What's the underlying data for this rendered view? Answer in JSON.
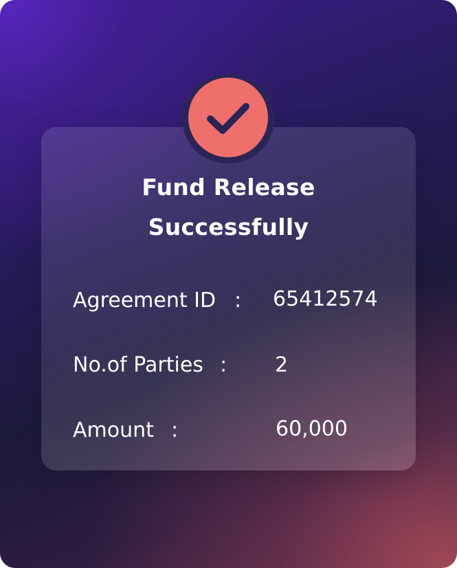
{
  "title": {
    "line1": "Fund Release",
    "line2": "Successfully"
  },
  "badge": {
    "icon": "checkmark-icon",
    "color": "#ef6f6c",
    "check_color": "#2b2456"
  },
  "details": [
    {
      "label": "Agreement ID",
      "separator": ":",
      "value": "65412574"
    },
    {
      "label": "No.of Parties",
      "separator": ":",
      "value": "2"
    },
    {
      "label": "Amount",
      "separator": ":",
      "value": "60,000"
    }
  ],
  "colors": {
    "card_overlay": "rgba(255,255,255,0.12)",
    "text": "#ffffff",
    "accent": "#ef6f6c"
  }
}
